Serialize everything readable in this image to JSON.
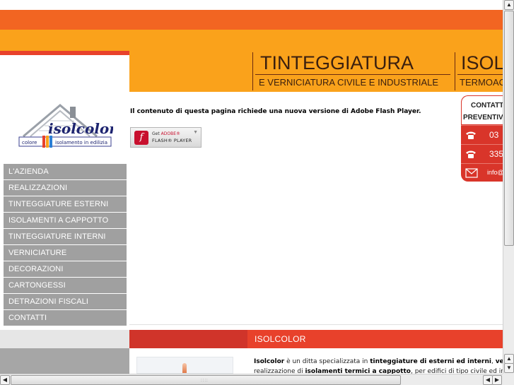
{
  "header": {
    "title1": "TINTEGGIATURA",
    "subtitle1": "E VERNICIATURA CIVILE E INDUSTRIALE",
    "title2": "ISOL",
    "subtitle2": "TERMOAC"
  },
  "logo": {
    "brand": "isolcolor",
    "tagline_left": "colore",
    "tagline_right": "isolamento in edilizia"
  },
  "menu": {
    "items": [
      {
        "label": "L'AZIENDA"
      },
      {
        "label": "REALIZZAZIONI"
      },
      {
        "label": "TINTEGGIATURE ESTERNI"
      },
      {
        "label": "ISOLAMENTI A CAPPOTTO"
      },
      {
        "label": "TINTEGGIATURE INTERNI"
      },
      {
        "label": "VERNICIATURE"
      },
      {
        "label": "DECORAZIONI"
      },
      {
        "label": "CARTONGESSI"
      },
      {
        "label": "DETRAZIONI FISCALI"
      },
      {
        "label": "CONTATTI"
      }
    ]
  },
  "flash": {
    "message": "Il contenuto di questa pagina richiede una nuova versione di Adobe Flash Player.",
    "button_get": "Get",
    "button_adobe": "ADOBE®",
    "button_player": "FLASH® PLAYER"
  },
  "contact": {
    "line1": "CONTATTA",
    "line2": "PREVENTIV",
    "phone1": "03",
    "phone2": "335",
    "email": "info@"
  },
  "section": {
    "title": "ISOLCOLOR"
  },
  "body": {
    "line1_b1": "Isolcolor",
    "line1_t1": " è un ditta specializzata in ",
    "line1_b2": "tinteggiature di esterni ed interni",
    "line1_t2": ", ",
    "line1_b3": "vernicia",
    "line2_t1": "realizzazione di ",
    "line2_b1": "isolamenti termici a cappotto",
    "line2_t2": ", per edifici di tipo civile ed indus"
  },
  "colors": {
    "orange_dark": "#f26522",
    "orange_light": "#faa21b",
    "red": "#e8412b",
    "menu_grey": "#a0a0a0"
  }
}
